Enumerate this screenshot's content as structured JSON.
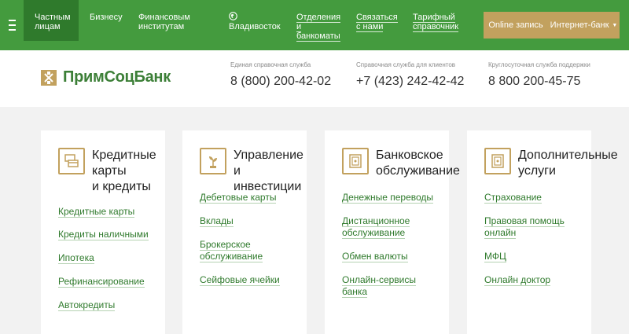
{
  "topbar": {
    "nav": [
      {
        "label": "Частным\nлицам"
      },
      {
        "label": "Бизнесу"
      },
      {
        "label": "Финансовым\nинститутам"
      },
      {
        "label": "Владивосток"
      },
      {
        "label": "Отделения\nи\nбанкоматы"
      },
      {
        "label": "Связаться\nс нами"
      },
      {
        "label": "Тарифный\nсправочник"
      }
    ],
    "online_label": "Online запись",
    "ibank_label": "Интернет-банк",
    "accent": "#449b3e",
    "gold": "#c2a15e"
  },
  "header": {
    "logo_text": "ПримСоцБанк",
    "contacts": [
      {
        "label": "Единая справочная служба",
        "number": "8 (800) 200-42-02"
      },
      {
        "label": "Справочная служба для клиентов",
        "number": "+7 (423) 242-42-42"
      },
      {
        "label": "Круглосуточная служба поддержки",
        "number": "8 800 200-45-75"
      }
    ]
  },
  "cards": [
    {
      "icon": "cards-icon",
      "title": "Кредитные\nкарты\nи кредиты",
      "links": [
        "Кредитные карты",
        "Кредиты наличными",
        "Ипотека",
        "Рефинансирование",
        "Автокредиты"
      ]
    },
    {
      "icon": "plant-icon",
      "title": "Управление\nи инвестиции",
      "links": [
        "Дебетовые карты",
        "Вклады",
        "Брокерское\nобслуживание",
        "Сейфовые ячейки"
      ]
    },
    {
      "icon": "safe-icon",
      "title": "Банковское\nобслуживание",
      "links": [
        "Денежные переводы",
        "Дистанционное\nобслуживание",
        "Обмен валюты",
        "Онлайн-сервисы\nбанка"
      ]
    },
    {
      "icon": "safe-icon",
      "title": "Дополнительные\nуслуги",
      "links": [
        "Страхование",
        "Правовая помощь\nонлайн",
        "МФЦ",
        "Онлайн доктор"
      ]
    }
  ]
}
